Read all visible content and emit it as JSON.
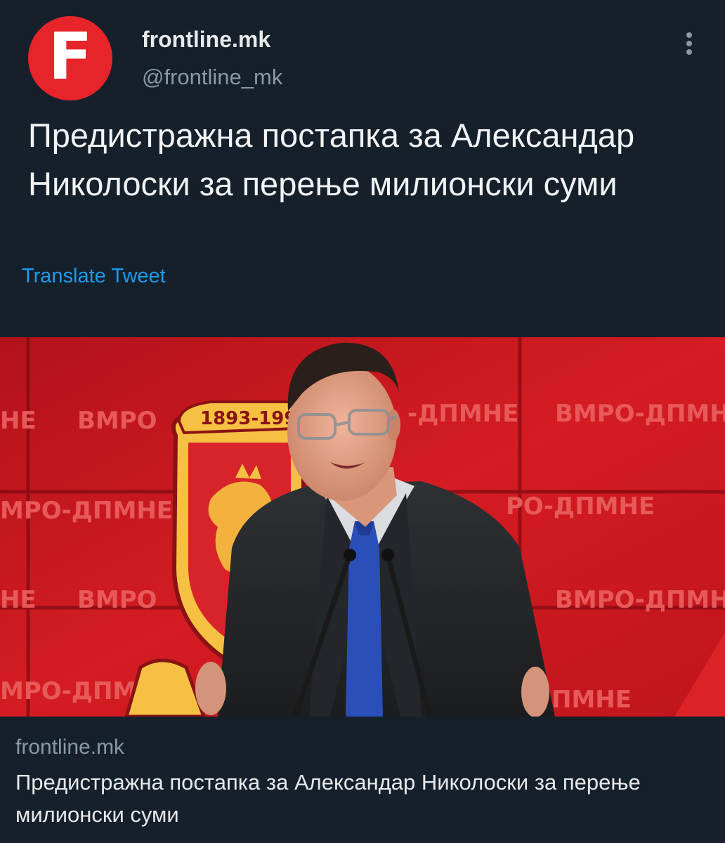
{
  "account": {
    "avatar_letter": "F",
    "avatar_color": "#e8242b",
    "display_name": "frontline.mk",
    "handle": "@frontline_mk",
    "more_icon": "more-vertical-icon"
  },
  "tweet": {
    "text": "Предистражна постапка за Александар Николоски за перење милионски суми",
    "translate_label": "Translate Tweet"
  },
  "card": {
    "image_alt": "Man in dark suit and blue tie speaking at a podium in front of a red VMRO-DPMNE backdrop",
    "image_texts": {
      "banner_years": "1893-199",
      "wall_1": "ВМРО",
      "wall_2": "-ДПМНЕ",
      "wall_3": "ВМРО-ДПМН",
      "wall_4": "МРО-ДПМНЕ",
      "wall_5": "РО-ДПМНЕ",
      "wall_6": "ВМРО",
      "wall_7": "ВМРО-ДПМН",
      "wall_8": "МРО-ДПМНЕ",
      "wall_9": "ПМНЕ",
      "wall_10": "НЕ",
      "wall_11": "НЕ"
    },
    "domain": "frontline.mk",
    "title": "Предистражна постапка за Александар Николоски за перење милионски суми"
  },
  "colors": {
    "background": "#15202b",
    "text_primary": "#e7e9ea",
    "text_secondary": "#8b98a5",
    "link": "#1d9bf0",
    "backdrop_red": "#c4151c"
  }
}
